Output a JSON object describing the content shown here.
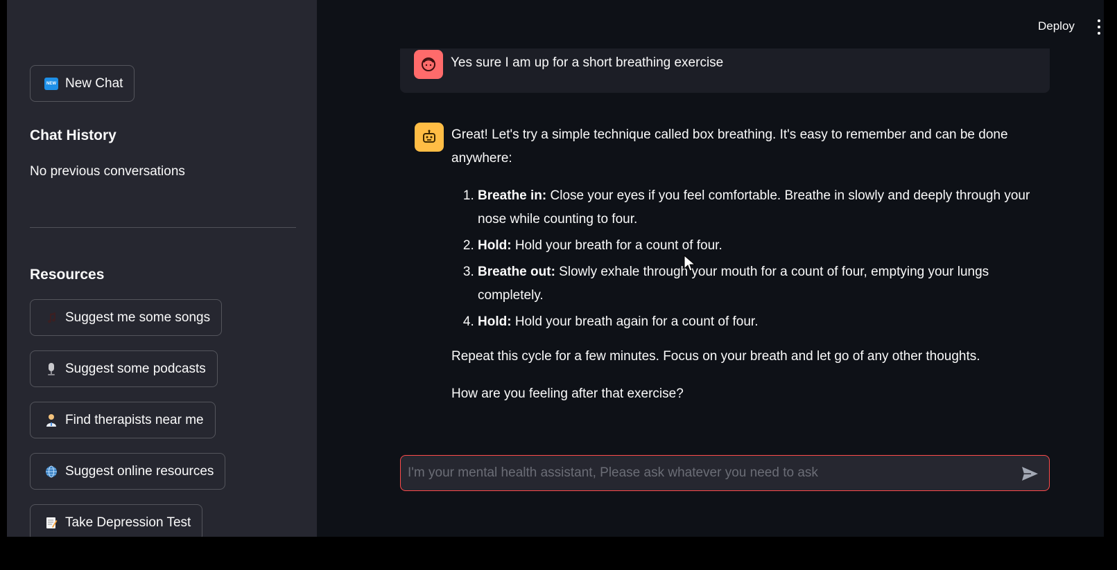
{
  "header": {
    "deploy_label": "Deploy"
  },
  "sidebar": {
    "new_chat_label": "New Chat",
    "new_badge": "NEW",
    "history_heading": "Chat History",
    "history_empty": "No previous conversations",
    "resources_heading": "Resources",
    "resources": [
      {
        "icon": "music-note-icon",
        "label": "Suggest me some songs"
      },
      {
        "icon": "microphone-icon",
        "label": "Suggest some podcasts"
      },
      {
        "icon": "health-worker-icon",
        "label": "Find therapists near me"
      },
      {
        "icon": "globe-icon",
        "label": "Suggest online resources"
      },
      {
        "icon": "memo-icon",
        "label": "Take Depression Test"
      }
    ]
  },
  "chat": {
    "user_message": "Yes sure I am up for a short breathing exercise",
    "assistant": {
      "intro": "Great! Let's try a simple technique called box breathing. It's easy to remember and can be done anywhere:",
      "steps": [
        {
          "title": "Breathe in:",
          "text": " Close your eyes if you feel comfortable. Breathe in slowly and deeply through your nose while counting to four."
        },
        {
          "title": "Hold:",
          "text": " Hold your breath for a count of four."
        },
        {
          "title": "Breathe out:",
          "text": " Slowly exhale through your mouth for a count of four, emptying your lungs completely."
        },
        {
          "title": "Hold:",
          "text": " Hold your breath again for a count of four."
        }
      ],
      "repeat": "Repeat this cycle for a few minutes. Focus on your breath and let go of any other thoughts.",
      "question": "How are you feeling after that exercise?"
    }
  },
  "input": {
    "placeholder": "I'm your mental health assistant, Please ask whatever you need to ask",
    "value": ""
  },
  "colors": {
    "accent": "#ff4b4b",
    "user_avatar": "#ff6b6b",
    "bot_avatar": "#ffbd45",
    "sidebar_bg": "#262730",
    "main_bg": "#0e1117"
  }
}
